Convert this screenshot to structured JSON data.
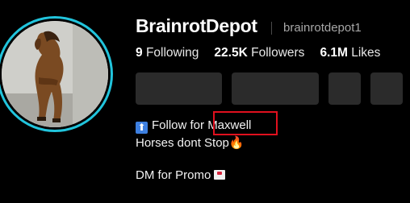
{
  "profile": {
    "username": "BrainrotDepot",
    "handle": "brainrotdepot1",
    "avatar_alt": "horse leaning against wall"
  },
  "stats": [
    {
      "value": "9",
      "label": "Following"
    },
    {
      "value": "22.5K",
      "label": "Followers"
    },
    {
      "value": "6.1M",
      "label": "Likes"
    }
  ],
  "bio": {
    "line1_prefix": "Follow for ",
    "line1_highlight": "Maxwell",
    "line2_text": "Horses dont Stop",
    "line2_emoji": "🔥",
    "line3_text": "DM for Promo",
    "arrow_badge": "⬆",
    "mail_icon": "envelope-icon"
  },
  "colors": {
    "background": "#000000",
    "avatar_ring": "#21c4dc",
    "button": "#2b2b2b",
    "highlight_box": "#e0101e",
    "handle": "#a7a7a7"
  }
}
